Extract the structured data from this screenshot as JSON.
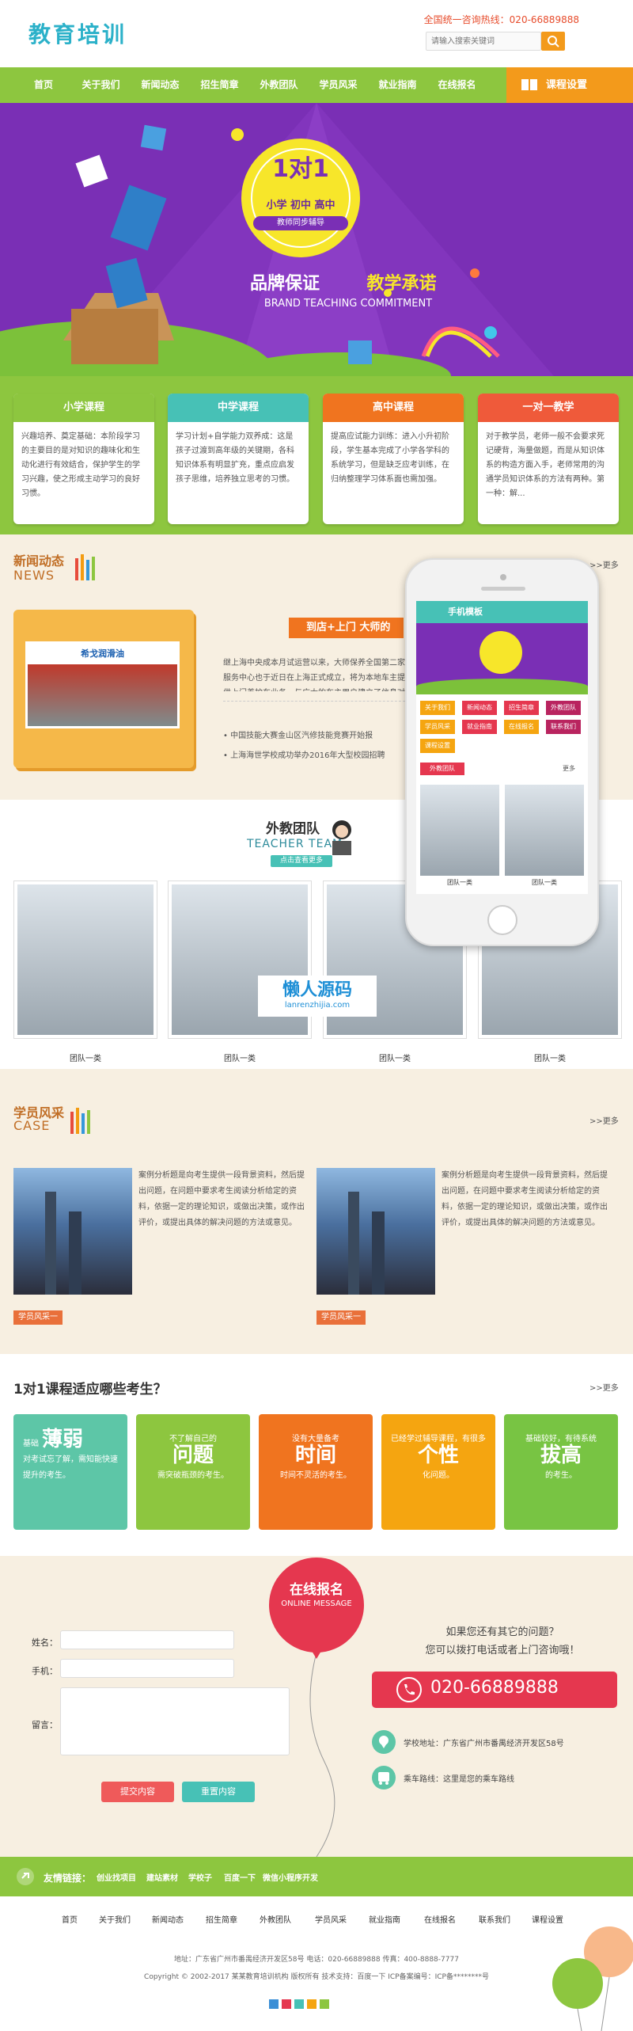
{
  "header": {
    "logo": "教育培训",
    "hotline": "全国统一咨询热线：020-66889888",
    "search_placeholder": "请输入搜索关键词"
  },
  "nav": {
    "items": [
      "首页",
      "关于我们",
      "新闻动态",
      "招生简章",
      "外教团队",
      "学员风采",
      "就业指南",
      "在线报名"
    ],
    "course_settings": "课程设置"
  },
  "banner": {
    "big": "1对1",
    "levels": "小学 初中 高中",
    "sync": "教师同步辅导",
    "slogan_left": "品牌保证",
    "slogan_right": "教学承诺",
    "slogan_en": "BRAND TEACHING COMMITMENT"
  },
  "courses": [
    {
      "title": "小学课程",
      "text": "兴趣培养、奠定基础：本阶段学习的主要目的是对知识的趣味化和生动化进行有效结合，保护学生的学习兴趣，使之形成主动学习的良好习惯。",
      "color": "#8dc63f"
    },
    {
      "title": "中学课程",
      "text": "学习计划+自学能力双养成：这是孩子过渡到高年级的关键期，各科知识体系有明显扩充，重点应启发孩子思维，培养独立思考的习惯。",
      "color": "#47c1b6"
    },
    {
      "title": "高中课程",
      "text": "提高应试能力训练：进入小升初阶段，学生基本完成了小学各学科的系统学习，但是缺乏应考训练，在归纳整理学习体系面也需加强。",
      "color": "#f0741f"
    },
    {
      "title": "一对一教学",
      "text": "对于教学员，老师一般不会要求死记硬背，海量做题，而是从知识体系的构造方面入手，老师常用的沟通学员知识体系的方法有两种。第一种：解...",
      "color": "#ef5a3a"
    }
  ],
  "news": {
    "title": "新闻动态",
    "title_en": "NEWS",
    "more": ">>更多",
    "calendar_sign": "希戈润滑油",
    "featured_title": "到店+上门 大师的",
    "featured_text": "继上海中央成本月试运营以来，大师保养全国第二家服务中心也于近日在上海正式成立，将为本地车主提供上门养护车业务，与广大的车主用户建立了信息对称的服务关系。",
    "items": [
      "中国技能大赛金山区汽修技能竞赛开始报",
      "上海海世学校成功举办2016年大型校园招聘"
    ]
  },
  "teachers": {
    "title": "外教团队",
    "title_en": "TEACHER TEAM",
    "sub": "点击查看更多",
    "watermark": "懒人源码",
    "watermark_url": "lanrenzhijia.com",
    "captions": [
      "团队一类",
      "团队一类",
      "团队一类",
      "团队一类"
    ]
  },
  "phone": {
    "site": "手机模板",
    "menu": [
      "关于我们",
      "新闻动态",
      "招生简章",
      "外教团队",
      "学员风采",
      "就业指南",
      "在线报名",
      "联系我们",
      "课程设置"
    ],
    "tab": "外教团队",
    "more": "更多",
    "captions": [
      "团队一类",
      "团队一类"
    ]
  },
  "cases": {
    "title": "学员风采",
    "title_en": "CASE",
    "more": ">>更多",
    "items": [
      {
        "text": "案例分析题是向考生提供一段背景资料，然后提出问题，在问题中要求考生阅读分析给定的资料，依据一定的理论知识，或做出决策，或作出评价，或提出具体的解决问题的方法或意见。",
        "tag": "学员风采一"
      },
      {
        "text": "案例分析题是向考生提供一段背景资料，然后提出问题，在问题中要求考生阅读分析给定的资料，依据一定的理论知识，或做出决策，或作出评价，或提出具体的解决问题的方法或意见。",
        "tag": "学员风采一"
      }
    ]
  },
  "suit": {
    "title": "1对1课程适应哪些考生？",
    "more": ">>更多",
    "cards": [
      {
        "pre": "基础",
        "big": "薄弱",
        "post": "对考试忘了解，需知能快速提升的考生。",
        "color": "#5dc6a7"
      },
      {
        "pre": "不了解自己的",
        "big": "问题",
        "post": "需突破瓶颈的考生。",
        "color": "#8dc63f"
      },
      {
        "pre": "没有大量备考",
        "big": "时间",
        "post": "时间不灵活的考生。",
        "color": "#f0741f"
      },
      {
        "pre": "已经学过辅导课程，有很多",
        "big": "个性",
        "post": "化问题。",
        "color": "#f5a510"
      },
      {
        "pre": "基础较好，有待系统",
        "big": "拔高",
        "post": "的考生。",
        "color": "#78c443"
      }
    ]
  },
  "message": {
    "balloon_cn": "在线报名",
    "balloon_en": "ONLINE MESSAGE",
    "name_label": "姓名：",
    "phone_label": "手机：",
    "msg_label": "留言：",
    "submit": "提交内容",
    "reset": "重置内容",
    "q1": "如果您还有其它的问题？",
    "q2": "您可以拨打电话或者上门咨询哦！",
    "phone": "020-66889888",
    "address": "学校地址：广东省广州市番禺经济开发区58号",
    "route": "乘车路线：这里是您的乘车路线"
  },
  "links": {
    "label": "友情链接：",
    "items": [
      "创业找项目",
      "建站素材",
      "学校子",
      "百度一下",
      "微信小程序开发"
    ]
  },
  "footer": {
    "nav": [
      "首页",
      "关于我们",
      "新闻动态",
      "招生简章",
      "外教团队",
      "学员风采",
      "就业指南",
      "在线报名",
      "联系我们",
      "课程设置"
    ],
    "address": "地址：广东省广州市番禺经济开发区58号   电话：020-66889888   传真：400-8888-7777",
    "copyright": "Copyright © 2002-2017 某某教育培训机构 版权所有   技术支持：百度一下   ICP备案编号：ICP备********号"
  }
}
